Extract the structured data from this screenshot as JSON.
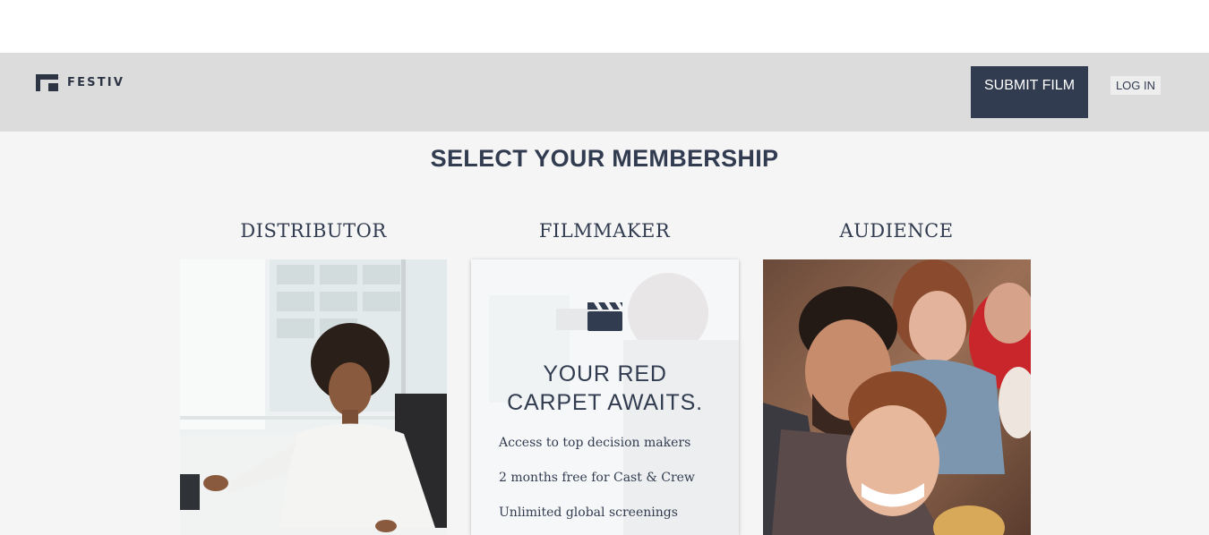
{
  "header": {
    "brand": "FESTIV",
    "submit_label": "SUBMIT FILM",
    "login_label": "LOG IN"
  },
  "page": {
    "title": "SELECT YOUR MEMBERSHIP"
  },
  "memberships": [
    {
      "title": "DISTRIBUTOR"
    },
    {
      "title": "FILMMAKER",
      "headline_line1": "YOUR RED",
      "headline_line2": "CARPET AWAITS.",
      "features": [
        "Access to top decision makers",
        "2 months free for Cast & Crew",
        "Unlimited global screenings"
      ]
    },
    {
      "title": "AUDIENCE"
    }
  ],
  "colors": {
    "primary": "#323c50",
    "header_bg": "#dcdcdc",
    "page_bg": "#f5f5f5"
  }
}
